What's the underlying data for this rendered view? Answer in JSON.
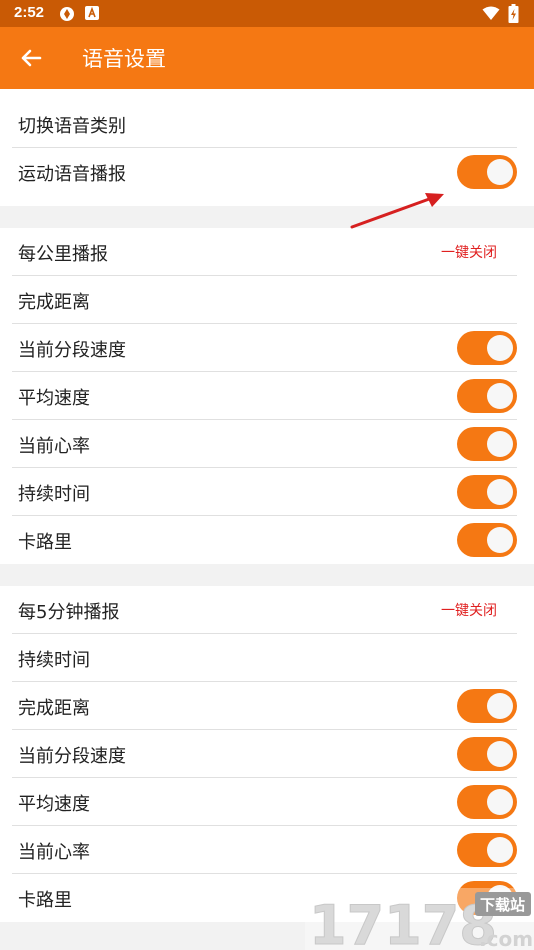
{
  "status_bar": {
    "time": "2:52",
    "icons": [
      "settings-sync-icon",
      "a-badge-icon",
      "wifi-icon",
      "battery-icon"
    ]
  },
  "app_bar": {
    "title": "语音设置",
    "back_icon": "arrow-left-icon",
    "color": "#f57813"
  },
  "top_section": {
    "items": [
      {
        "label": "切换语音类别"
      },
      {
        "label": "运动语音播报",
        "toggle_on": true
      }
    ]
  },
  "per_km_section": {
    "header": "每公里播报",
    "close_all": "一键关闭",
    "items": [
      {
        "label": "完成距离"
      },
      {
        "label": "当前分段速度",
        "toggle_on": true
      },
      {
        "label": "平均速度",
        "toggle_on": true
      },
      {
        "label": "当前心率",
        "toggle_on": true
      },
      {
        "label": "持续时间",
        "toggle_on": true
      },
      {
        "label": "卡路里",
        "toggle_on": true
      }
    ]
  },
  "per_5min_section": {
    "header": "每5分钟播报",
    "close_all": "一键关闭",
    "items": [
      {
        "label": "持续时间"
      },
      {
        "label": "完成距离",
        "toggle_on": true
      },
      {
        "label": "当前分段速度",
        "toggle_on": true
      },
      {
        "label": "平均速度",
        "toggle_on": true
      },
      {
        "label": "当前心率",
        "toggle_on": true
      },
      {
        "label": "卡路里",
        "toggle_on": true
      }
    ]
  },
  "watermark": {
    "brand": "17178",
    "domain": ".com",
    "tag": "下载站"
  },
  "colors": {
    "accent": "#f57813",
    "status_bar": "#c95a05",
    "close_all_text": "#e02020",
    "section_gap": "#f2f2f2"
  }
}
